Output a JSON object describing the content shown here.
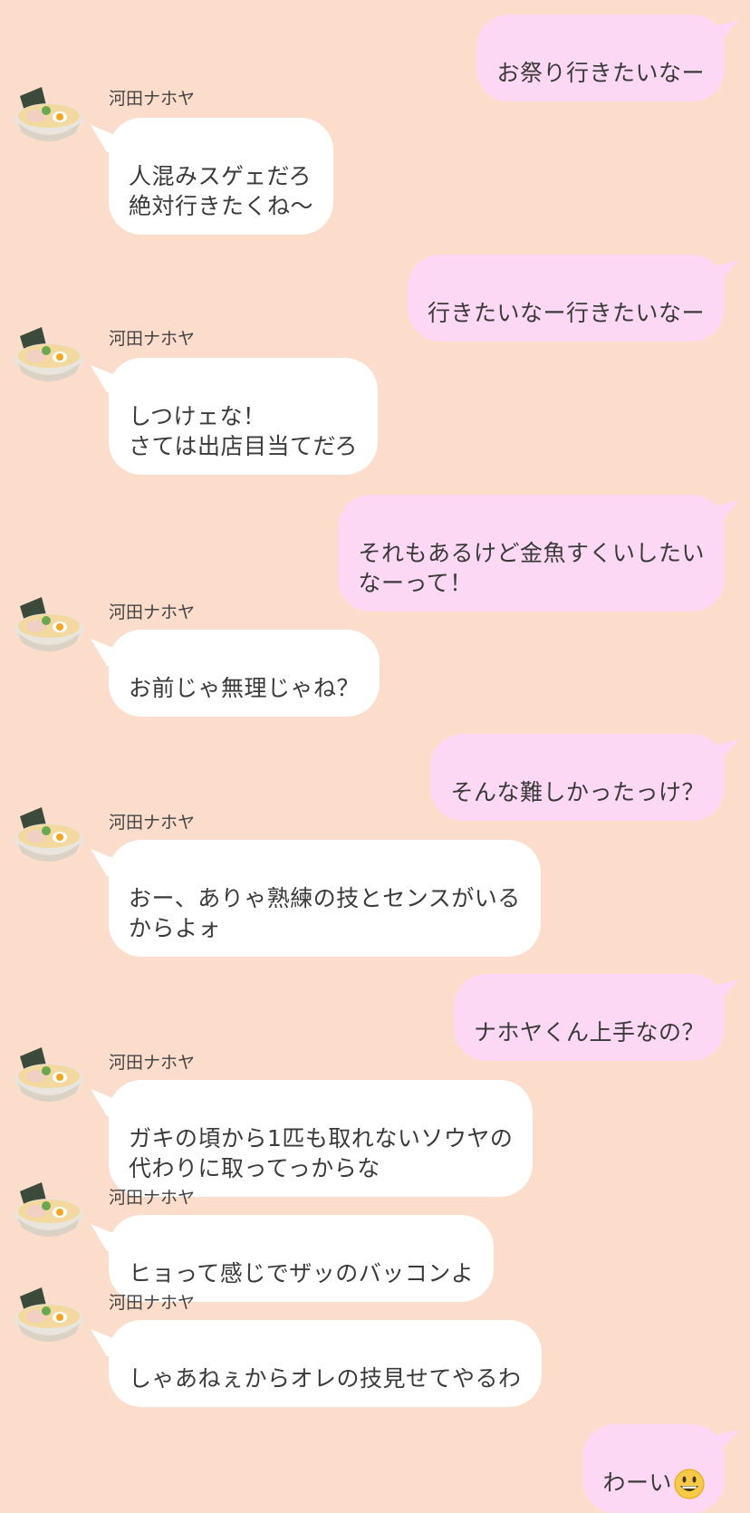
{
  "chat": {
    "contact_name": "河田ナホヤ",
    "messages": [
      {
        "side": "out",
        "text": "お祭り行きたいなー"
      },
      {
        "side": "in",
        "text": "人混みスゲェだろ\n絶対行きたくね〜"
      },
      {
        "side": "out",
        "text": "行きたいなー行きたいなー"
      },
      {
        "side": "in",
        "text": "しつけェな！\nさては出店目当てだろ"
      },
      {
        "side": "out",
        "text": "それもあるけど金魚すくいしたい\nなーって！"
      },
      {
        "side": "in",
        "text": "お前じゃ無理じゃね？"
      },
      {
        "side": "out",
        "text": "そんな難しかったっけ？"
      },
      {
        "side": "in",
        "text": "おー、ありゃ熟練の技とセンスがいる\nからよォ"
      },
      {
        "side": "out",
        "text": "ナホヤくん上手なの？"
      },
      {
        "side": "in",
        "text": "ガキの頃から1匹も取れないソウヤの\n代わりに取ってっからな"
      },
      {
        "side": "in",
        "text": "ヒョって感じでザッのバッコンよ"
      },
      {
        "side": "in",
        "text": "しゃあねぇからオレの技見せてやるわ"
      },
      {
        "side": "out",
        "text": "わーい",
        "emoji": "grinning-face-emoji"
      }
    ]
  },
  "colors": {
    "background": "#fcdccb",
    "outgoing_bubble": "#fdd8f4",
    "incoming_bubble": "#ffffff"
  },
  "icons": {
    "avatar": "ramen-bowl-avatar-icon"
  }
}
